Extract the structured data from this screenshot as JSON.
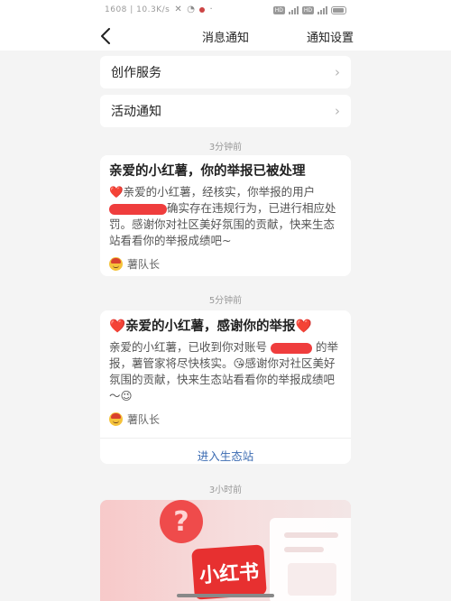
{
  "status_bar": {
    "left_text": "1608 | 10.3K/s",
    "hd_tag_1": "HD",
    "hd_tag_2": "HD",
    "battery_percent": 90
  },
  "nav": {
    "title": "消息通知",
    "settings": "通知设置",
    "back_icon": "chevron-left-icon"
  },
  "menu": [
    {
      "label": "创作服务",
      "icon": "chevron-right-icon"
    },
    {
      "label": "活动通知",
      "icon": "chevron-right-icon"
    }
  ],
  "timestamps": [
    "3分钟前",
    "5分钟前",
    "3小时前"
  ],
  "card1": {
    "title": "亲爱的小红薯，你的举报已被处理",
    "heart": "❤️",
    "body_a": "亲爱的小红薯，经核实，你举报的用户",
    "body_b": "确实存在违规行为，已进行相应处罚。感谢你对社区美好氛围的贡献，快来生态站看看你的举报成绩吧~",
    "author": "薯队长"
  },
  "card2": {
    "heart_left": "❤️",
    "title": "亲爱的小红薯，感谢你的举报",
    "heart_right": "❤️",
    "body_a": "亲爱的小红薯，已收到你对账号",
    "body_b": "的举报，薯管家将尽快核实。",
    "emoji_kiss": "😘",
    "body_c": "感谢你对社区美好氛围的贡献，快来生态站看看你的举报成绩吧～",
    "emoji_wink": "😉",
    "author": "薯队长",
    "action": "进入生态站"
  },
  "promo": {
    "logo_text": "小红书",
    "bubble_text": "?"
  },
  "colors": {
    "accent_red": "#e23b3b",
    "link_blue": "#3b6bb2",
    "page_bg": "#f4f4f4"
  }
}
